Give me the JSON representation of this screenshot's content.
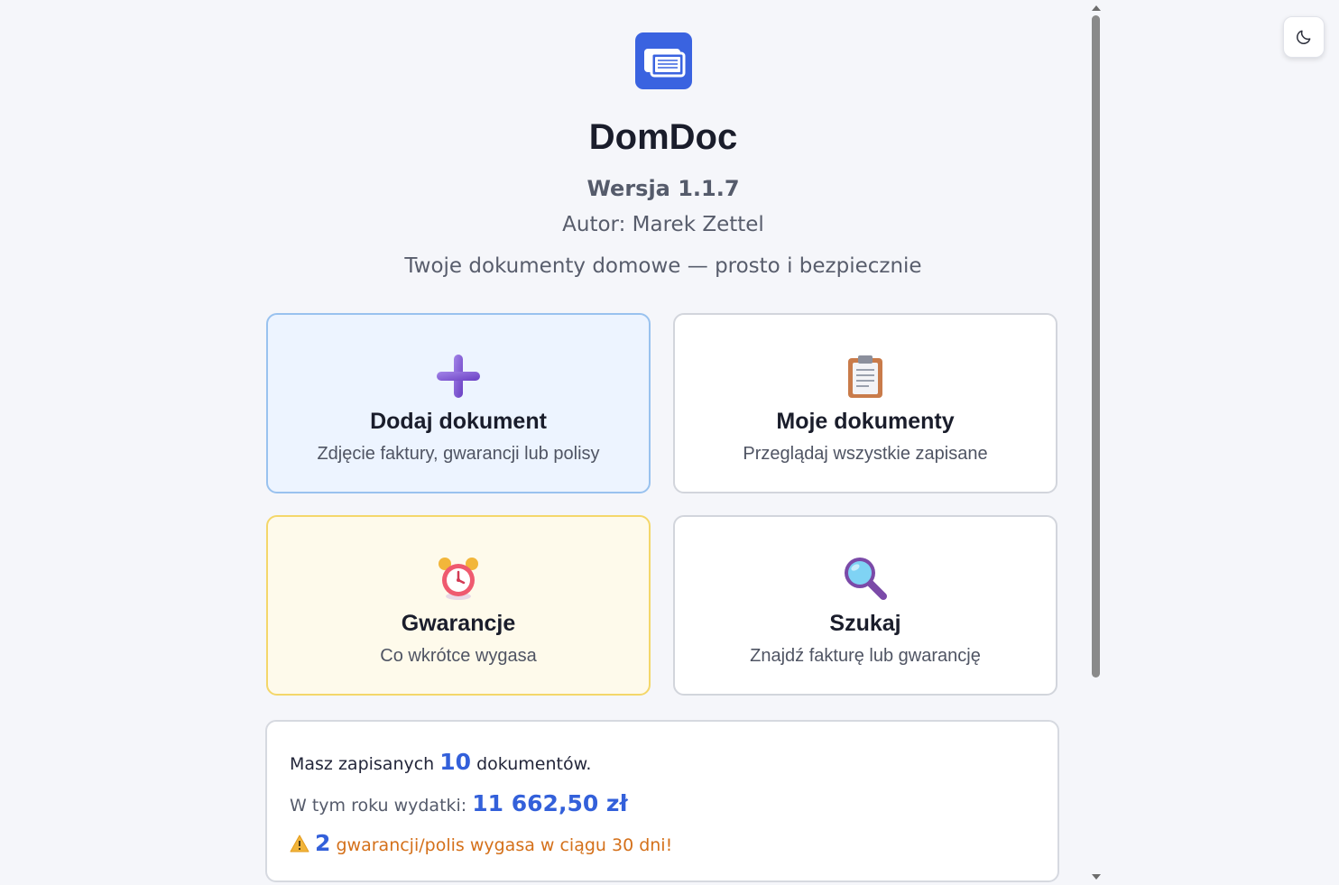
{
  "app": {
    "title": "DomDoc",
    "version": "Wersja 1.1.7",
    "author": "Autor: Marek Zettel",
    "tagline": "Twoje dokumenty domowe — prosto i bezpiecznie",
    "logo_icon": "document-stack-icon",
    "accent_color": "#3a63e0"
  },
  "theme_toggle": {
    "icon": "moon-icon"
  },
  "cards": [
    {
      "icon": "plus-icon",
      "title": "Dodaj dokument",
      "subtitle": "Zdjęcie faktury, gwarancji lub polisy",
      "style": "blue"
    },
    {
      "icon": "clipboard-icon",
      "title": "Moje dokumenty",
      "subtitle": "Przeglądaj wszystkie zapisane",
      "style": "white"
    },
    {
      "icon": "alarm-clock-icon",
      "title": "Gwarancje",
      "subtitle": "Co wkrótce wygasa",
      "style": "yellow"
    },
    {
      "icon": "magnifier-icon",
      "title": "Szukaj",
      "subtitle": "Znajdź fakturę lub gwarancję",
      "style": "white"
    }
  ],
  "stats": {
    "docs_prefix": "Masz zapisanych",
    "docs_count": "10",
    "docs_suffix": "dokumentów.",
    "spend_prefix": "W tym roku wydatki:",
    "spend_value": "11 662,50 zł",
    "warning_icon": "warning-icon",
    "warning_count": "2",
    "warning_text": "gwarancji/polis wygasa w ciągu 30 dni!"
  }
}
